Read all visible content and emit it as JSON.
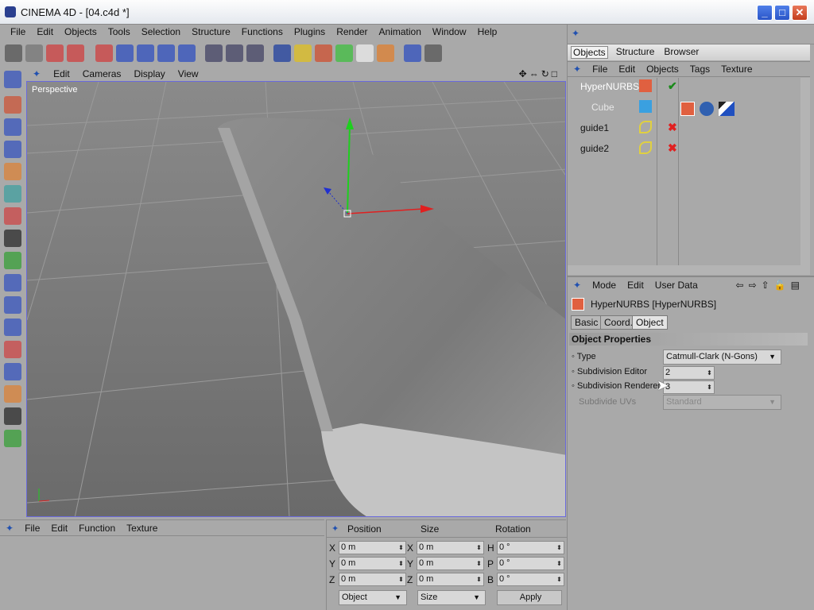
{
  "window": {
    "title": "CINEMA 4D - [04.c4d *]",
    "minimize": "_",
    "maximize": "□",
    "close": "✕"
  },
  "menu": [
    "File",
    "Edit",
    "Objects",
    "Tools",
    "Selection",
    "Structure",
    "Functions",
    "Plugins",
    "Render",
    "Animation",
    "Window",
    "Help"
  ],
  "viewport": {
    "menu": [
      "Edit",
      "Cameras",
      "Display",
      "View"
    ],
    "camera_label": "Perspective"
  },
  "object_manager": {
    "tabs": [
      "Objects",
      "Structure",
      "Browser"
    ],
    "active_tab": "Objects",
    "menu": [
      "File",
      "Edit",
      "Objects",
      "Tags",
      "Texture"
    ],
    "objects": [
      {
        "name": "HyperNURBS",
        "status": "enabled"
      },
      {
        "name": "Cube",
        "status": "child"
      },
      {
        "name": "guide1",
        "status": "disabled"
      },
      {
        "name": "guide2",
        "status": "disabled"
      }
    ]
  },
  "attributes": {
    "menu": [
      "Mode",
      "Edit",
      "User Data"
    ],
    "object_title": "HyperNURBS [HyperNURBS]",
    "tabs": [
      "Basic",
      "Coord.",
      "Object"
    ],
    "active_tab": "Object",
    "section": "Object Properties",
    "props": {
      "type_label": "Type",
      "type_value": "Catmull-Clark (N-Gons)",
      "sub_editor_label": "Subdivision Editor",
      "sub_editor_value": "2",
      "sub_render_label": "Subdivision Renderer",
      "sub_render_value": "3",
      "uv_label": "Subdivide UVs",
      "uv_value": "Standard"
    }
  },
  "material_manager": {
    "menu": [
      "File",
      "Edit",
      "Function",
      "Texture"
    ]
  },
  "coordinates": {
    "headers": [
      "Position",
      "Size",
      "Rotation"
    ],
    "rows": [
      {
        "pl": "X",
        "pv": "0 m",
        "sl": "X",
        "sv": "0 m",
        "rl": "H",
        "rv": "0 °"
      },
      {
        "pl": "Y",
        "pv": "0 m",
        "sl": "Y",
        "sv": "0 m",
        "rl": "P",
        "rv": "0 °"
      },
      {
        "pl": "Z",
        "pv": "0 m",
        "sl": "Z",
        "sv": "0 m",
        "rl": "B",
        "rv": "0 °"
      }
    ],
    "mode": "Object",
    "size_mode": "Size",
    "apply": "Apply"
  },
  "colors": {
    "accent": "#6a6adc",
    "enabled": "#1a8a1a",
    "disabled": "#e02020"
  }
}
